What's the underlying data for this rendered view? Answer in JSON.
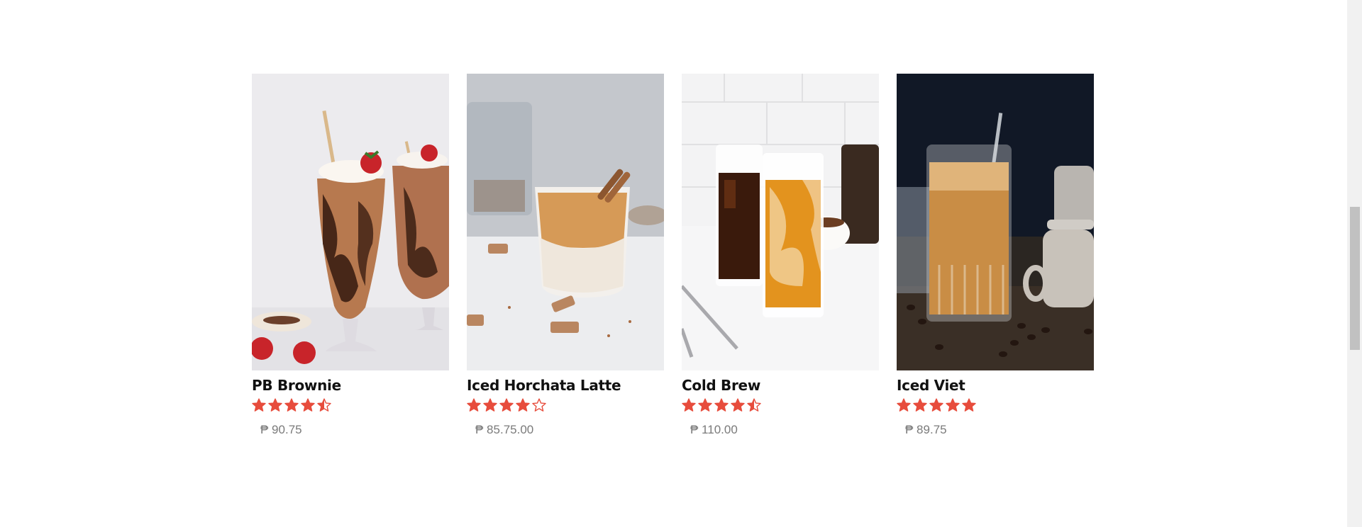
{
  "colors": {
    "star": "#e74c3c",
    "title": "#111111",
    "price": "#7a7a7a"
  },
  "products": [
    {
      "name": "PB Brownie",
      "rating": 4.5,
      "rating_max": 5,
      "price": "₱ 90.75",
      "image": "pb-brownie-milkshake-photo"
    },
    {
      "name": "Iced Horchata Latte",
      "rating": 4,
      "rating_max": 5,
      "price": "₱ 85.75.00",
      "image": "iced-horchata-latte-photo"
    },
    {
      "name": "Cold Brew",
      "rating": 4.5,
      "rating_max": 5,
      "price": "₱ 110.00",
      "image": "cold-brew-photo"
    },
    {
      "name": "Iced Viet",
      "rating": 5,
      "rating_max": 5,
      "price": "₱ 89.75",
      "image": "iced-viet-coffee-photo"
    }
  ],
  "scrollbar": {
    "position_fraction": 0.39
  }
}
